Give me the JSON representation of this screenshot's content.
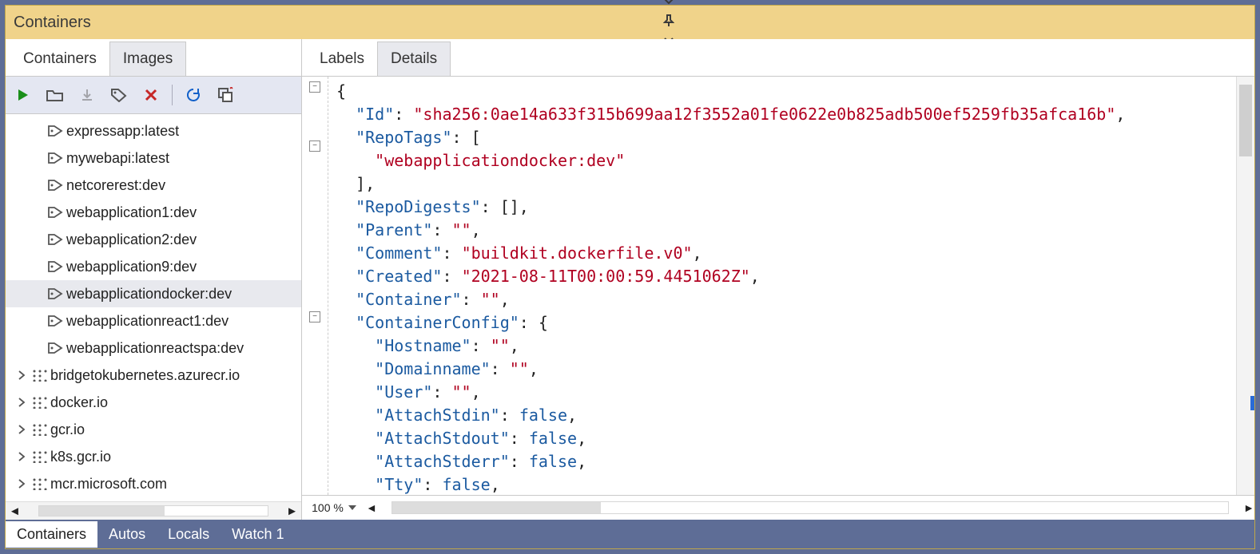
{
  "titlebar": {
    "title": "Containers"
  },
  "leftTabs": [
    {
      "label": "Containers",
      "active": false
    },
    {
      "label": "Images",
      "active": true
    }
  ],
  "toolbar": {
    "run": "Run",
    "open": "Open",
    "download": "Download",
    "tag": "Tag",
    "delete": "Delete",
    "refresh": "Refresh",
    "copy": "Copy"
  },
  "images": [
    {
      "kind": "tag",
      "label": "expressapp:latest"
    },
    {
      "kind": "tag",
      "label": "mywebapi:latest"
    },
    {
      "kind": "tag",
      "label": "netcorerest:dev"
    },
    {
      "kind": "tag",
      "label": "webapplication1:dev"
    },
    {
      "kind": "tag",
      "label": "webapplication2:dev"
    },
    {
      "kind": "tag",
      "label": "webapplication9:dev"
    },
    {
      "kind": "tag",
      "label": "webapplicationdocker:dev",
      "selected": true
    },
    {
      "kind": "tag",
      "label": "webapplicationreact1:dev"
    },
    {
      "kind": "tag",
      "label": "webapplicationreactspa:dev"
    },
    {
      "kind": "registry",
      "label": "bridgetokubernetes.azurecr.io"
    },
    {
      "kind": "registry",
      "label": "docker.io"
    },
    {
      "kind": "registry",
      "label": "gcr.io"
    },
    {
      "kind": "registry",
      "label": "k8s.gcr.io"
    },
    {
      "kind": "registry",
      "label": "mcr.microsoft.com"
    }
  ],
  "rightTabs": [
    {
      "label": "Labels",
      "active": false
    },
    {
      "label": "Details",
      "active": true
    }
  ],
  "zoom": "100 %",
  "json": {
    "Id": "sha256:0ae14a633f315b699aa12f3552a01fe0622e0b825adb500ef5259fb35afca16b",
    "RepoTags": [
      "webapplicationdocker:dev"
    ],
    "RepoDigests": [],
    "Parent": "",
    "Comment": "buildkit.dockerfile.v0",
    "Created": "2021-08-11T00:00:59.4451062Z",
    "Container": "",
    "ContainerConfig": {
      "Hostname": "",
      "Domainname": "",
      "User": "",
      "AttachStdin": false,
      "AttachStdout": false,
      "AttachStderr": false,
      "Tty": false
    }
  },
  "bottomTabs": [
    {
      "label": "Containers",
      "sel": true
    },
    {
      "label": "Autos"
    },
    {
      "label": "Locals"
    },
    {
      "label": "Watch 1"
    }
  ]
}
